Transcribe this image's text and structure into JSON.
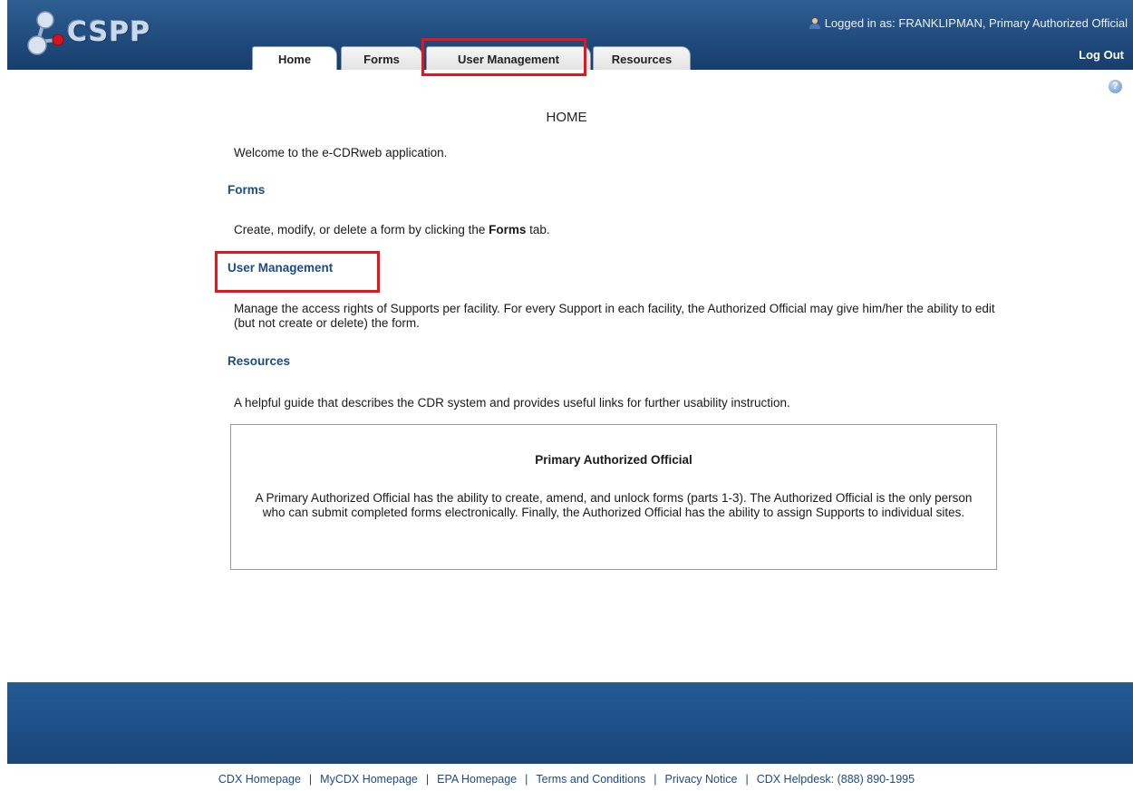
{
  "header": {
    "logo_text": "CSPP",
    "login_info": "Logged in as: FRANKLIPMAN, Primary Authorized Official",
    "logout_label": "Log Out",
    "tabs": [
      {
        "label": "Home",
        "active": true
      },
      {
        "label": "Forms",
        "active": false
      },
      {
        "label": "User Management",
        "active": false
      },
      {
        "label": "Resources",
        "active": false
      }
    ],
    "highlight_color": "#e8141b",
    "accent_color": "#1f4a7c"
  },
  "icons": {
    "logo": "molecule-logo-icon",
    "user": "user-icon",
    "help": "help-icon"
  },
  "main": {
    "title": "HOME",
    "welcome": "Welcome to the e-CDRweb application.",
    "forms": {
      "heading": "Forms",
      "text_before": "Create, modify, or delete a form by clicking the ",
      "text_bold": "Forms",
      "text_after": " tab."
    },
    "user_management": {
      "heading": "User Management",
      "text": "Manage the access rights of Supports per facility. For every Support in each facility, the Authorized Official may give him/her the ability to edit (but not create or delete) the form."
    },
    "resources": {
      "heading": "Resources",
      "text": "A helpful guide that describes the CDR system and provides useful links for further usability instruction."
    },
    "info_box": {
      "title": "Primary Authorized Official",
      "text": "A Primary Authorized Official has the ability to create, amend, and unlock forms (parts 1-3). The Authorized Official is the only person who can submit completed forms electronically. Finally, the Authorized Official has the ability to assign Supports to individual sites."
    }
  },
  "footer": {
    "links": [
      "CDX Homepage",
      "MyCDX Homepage",
      "EPA Homepage",
      "Terms and Conditions",
      "Privacy Notice",
      "CDX Helpdesk: (888) 890-1995"
    ],
    "separator": "|"
  }
}
